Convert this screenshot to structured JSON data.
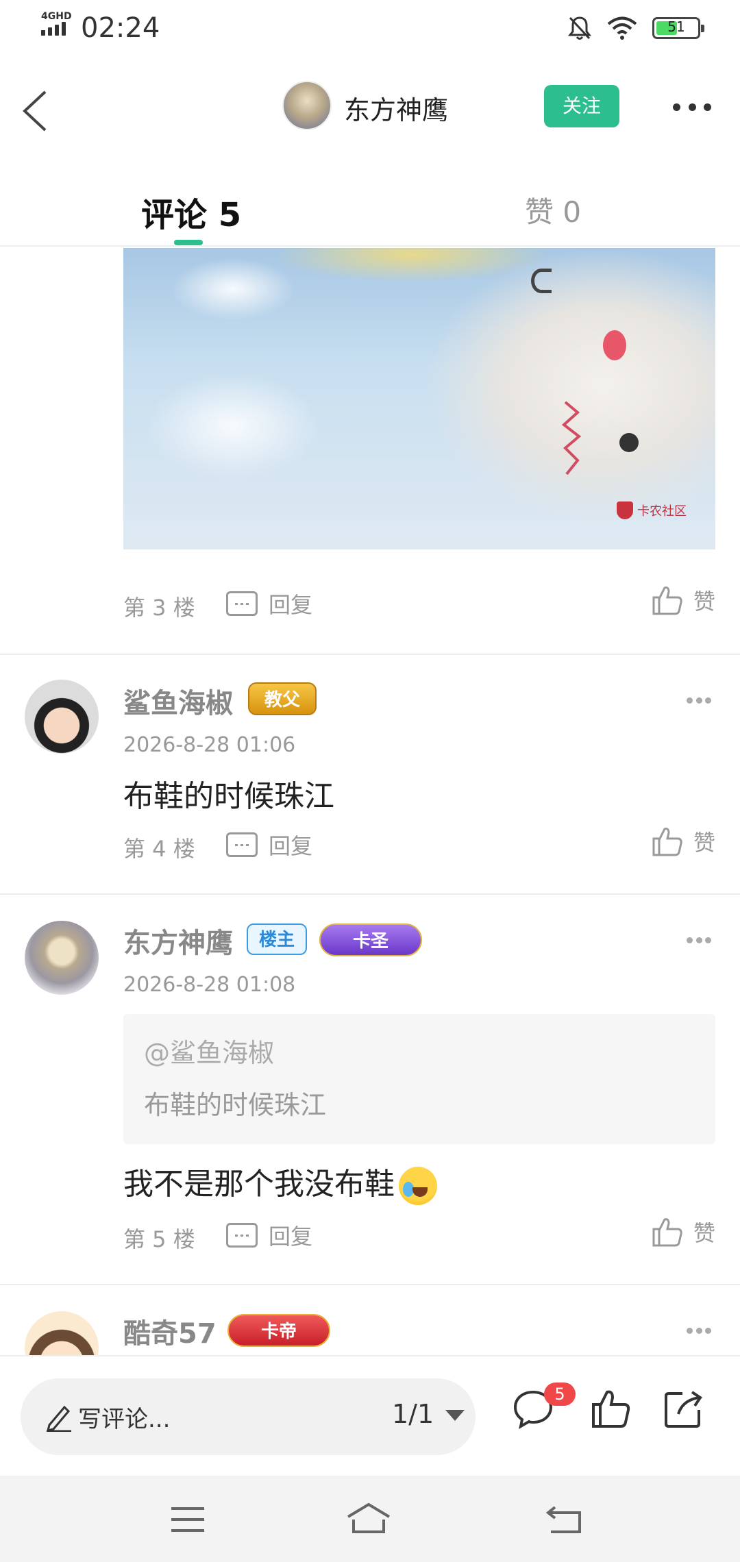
{
  "status_bar": {
    "network": "4GHD",
    "time": "02:24",
    "battery": "51"
  },
  "header": {
    "title": "东方神鹰",
    "follow_label": "关注"
  },
  "tabs": {
    "comments": "评论 5",
    "likes": "赞 0"
  },
  "image": {
    "watermark": "卡农社区"
  },
  "floors": [
    {
      "floor": "第 3 楼",
      "reply": "回复",
      "like": "赞"
    },
    {
      "name": "鲨鱼海椒",
      "badge": "教父",
      "date": "2026-8-28 01:06",
      "text": "布鞋的时候珠江",
      "floor": "第 4 楼",
      "reply": "回复",
      "like": "赞"
    },
    {
      "name": "东方神鹰",
      "tag": "楼主",
      "badge": "卡圣",
      "date": "2026-8-28 01:08",
      "quote_user": "@鲨鱼海椒",
      "quote_text": "布鞋的时候珠江",
      "text": "我不是那个我没布鞋",
      "floor": "第 5 楼",
      "reply": "回复",
      "like": "赞"
    },
    {
      "name": "酷奇57",
      "badge": "卡帝"
    }
  ],
  "bottom_bar": {
    "input_placeholder": "写评论...",
    "page_counter": "1/1",
    "comment_count": "5"
  },
  "colors": {
    "accent": "#2dbe8f",
    "badge_red": "#f04848"
  },
  "icons": [
    "back-icon",
    "more-icon",
    "reply-icon",
    "like-icon",
    "pencil-icon",
    "comment-icon",
    "thumbs-up-icon",
    "share-icon",
    "menu-icon",
    "home-icon",
    "back-nav-icon",
    "mute-icon",
    "wifi-icon",
    "battery-icon"
  ]
}
